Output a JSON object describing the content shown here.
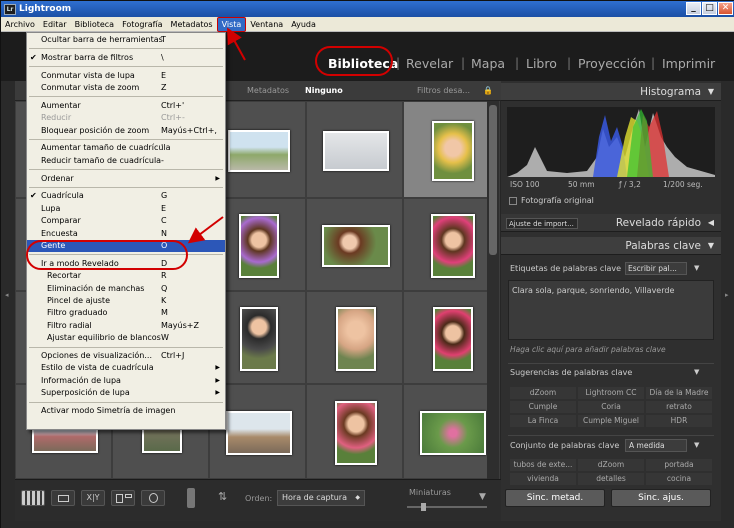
{
  "window": {
    "title": "Lightroom",
    "app_icon": "Lr",
    "minimize": "_",
    "maximize": "□",
    "close": "✕"
  },
  "menubar": [
    {
      "label": "Archivo",
      "active": false
    },
    {
      "label": "Editar",
      "active": false
    },
    {
      "label": "Biblioteca",
      "active": false
    },
    {
      "label": "Fotografía",
      "active": false
    },
    {
      "label": "Metadatos",
      "active": false
    },
    {
      "label": "Vista",
      "active": true
    },
    {
      "label": "Ventana",
      "active": false
    },
    {
      "label": "Ayuda",
      "active": false
    }
  ],
  "modules": [
    "Biblioteca",
    "Revelar",
    "Mapa",
    "Libro",
    "Proyección",
    "Imprimir"
  ],
  "filterbar": {
    "metadatos": "Metadatos",
    "ninguno": "Ninguno",
    "filtros": "Filtros desa..."
  },
  "menu": [
    {
      "label": "Ocultar barra de herramientas",
      "shortcut": "T"
    },
    {
      "sep": true
    },
    {
      "label": "Mostrar barra de filtros",
      "shortcut": "\\",
      "check": "✔"
    },
    {
      "sep": true
    },
    {
      "label": "Conmutar vista de lupa",
      "shortcut": "E"
    },
    {
      "label": "Conmutar vista de zoom",
      "shortcut": "Z"
    },
    {
      "sep": true
    },
    {
      "label": "Aumentar",
      "shortcut": "Ctrl+'"
    },
    {
      "label": "Reducir",
      "shortcut": "Ctrl+-",
      "disabled": true
    },
    {
      "label": "Bloquear posición de zoom",
      "shortcut": "Mayús+Ctrl+,"
    },
    {
      "sep": true
    },
    {
      "label": "Aumentar tamaño de cuadrícula",
      "shortcut": "'"
    },
    {
      "label": "Reducir tamaño de cuadrícula",
      "shortcut": "-"
    },
    {
      "sep": true
    },
    {
      "label": "Ordenar",
      "submenu": true
    },
    {
      "sep": true
    },
    {
      "label": "Cuadrícula",
      "shortcut": "G",
      "check": "✔"
    },
    {
      "label": "Lupa",
      "shortcut": "E"
    },
    {
      "label": "Comparar",
      "shortcut": "C"
    },
    {
      "label": "Encuesta",
      "shortcut": "N"
    },
    {
      "label": "Gente",
      "shortcut": "O",
      "highlight": true
    },
    {
      "sep": true
    },
    {
      "label": "Ir a modo Revelado",
      "shortcut": "D"
    },
    {
      "label": "Recortar",
      "shortcut": "R",
      "indent": true
    },
    {
      "label": "Eliminación de manchas",
      "shortcut": "Q",
      "indent": true
    },
    {
      "label": "Pincel de ajuste",
      "shortcut": "K",
      "indent": true
    },
    {
      "label": "Filtro graduado",
      "shortcut": "M",
      "indent": true
    },
    {
      "label": "Filtro radial",
      "shortcut": "Mayús+Z",
      "indent": true
    },
    {
      "label": "Ajustar equilibrio de blancos",
      "shortcut": "W",
      "indent": true
    },
    {
      "sep": true
    },
    {
      "label": "Opciones de visualización...",
      "shortcut": "Ctrl+J"
    },
    {
      "label": "Estilo de vista de cuadrícula",
      "submenu": true
    },
    {
      "label": "Información de lupa",
      "submenu": true
    },
    {
      "label": "Superposición de lupa",
      "submenu": true
    },
    {
      "sep": true
    },
    {
      "label": "Activar modo Simetría de imagen"
    }
  ],
  "toolbar": {
    "orden_label": "Orden:",
    "orden_value": "Hora de captura",
    "miniaturas": "Miniaturas"
  },
  "panels": {
    "histograma": "Histograma",
    "iso": "ISO 100",
    "focal": "50 mm",
    "aperture": "ƒ / 3,2",
    "shutter": "1/200 seg.",
    "original": "Fotografía original",
    "preset": "Ajuste de import...",
    "revelado": "Revelado rápido",
    "palabras": "Palabras clave",
    "etiquetas": "Etiquetas de palabras clave",
    "escribir": "Escribir pal...",
    "keywords": "Clara sola, parque, sonriendo, Villaverde",
    "hint": "Haga clic aquí para añadir palabras clave",
    "sugerencias": "Sugerencias de palabras clave",
    "suggestions": [
      "dZoom",
      "Lightroom CC",
      "Día de la Madre",
      "Cumple",
      "Coria",
      "retrato",
      "La Finca",
      "Cumple Miguel",
      "HDR"
    ],
    "conjunto": "Conjunto de palabras clave",
    "conjunto_value": "A medida",
    "set_items": [
      "tubos de exte...",
      "dZoom",
      "portada",
      "vivienda",
      "detalles",
      "cocina"
    ],
    "sinc_metad": "Sinc. metad.",
    "sinc_ajus": "Sinc. ajus."
  },
  "colors": {
    "accent": "#316ac5",
    "highlight": "#2c57b8",
    "annotation": "#d20000"
  },
  "icons": [
    "search-icon",
    "lock-icon",
    "grid-view-icon",
    "loupe-view-icon",
    "compare-view-icon",
    "survey-view-icon",
    "people-view-icon",
    "spray-can-icon",
    "sort-direction-icon",
    "dropdown-arrow-icon"
  ]
}
